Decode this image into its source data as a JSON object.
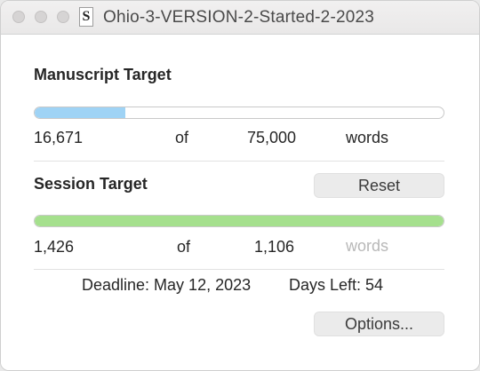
{
  "window": {
    "title": "Ohio-3-VERSION-2-Started-2-2023",
    "doc_icon_glyph": "S"
  },
  "manuscript": {
    "heading": "Manuscript Target",
    "progress_fraction": 0.222,
    "fill_color": "#9fd3f5",
    "current": "16,671",
    "of_label": "of",
    "target": "75,000",
    "unit": "words"
  },
  "session": {
    "heading": "Session Target",
    "reset_label": "Reset",
    "progress_fraction": 1.0,
    "fill_color": "#a5e08d",
    "current": "1,426",
    "of_label": "of",
    "target": "1,106",
    "unit": "words"
  },
  "footer": {
    "deadline": "Deadline: May 12, 2023",
    "days_left": "Days Left: 54",
    "options_label": "Options..."
  }
}
